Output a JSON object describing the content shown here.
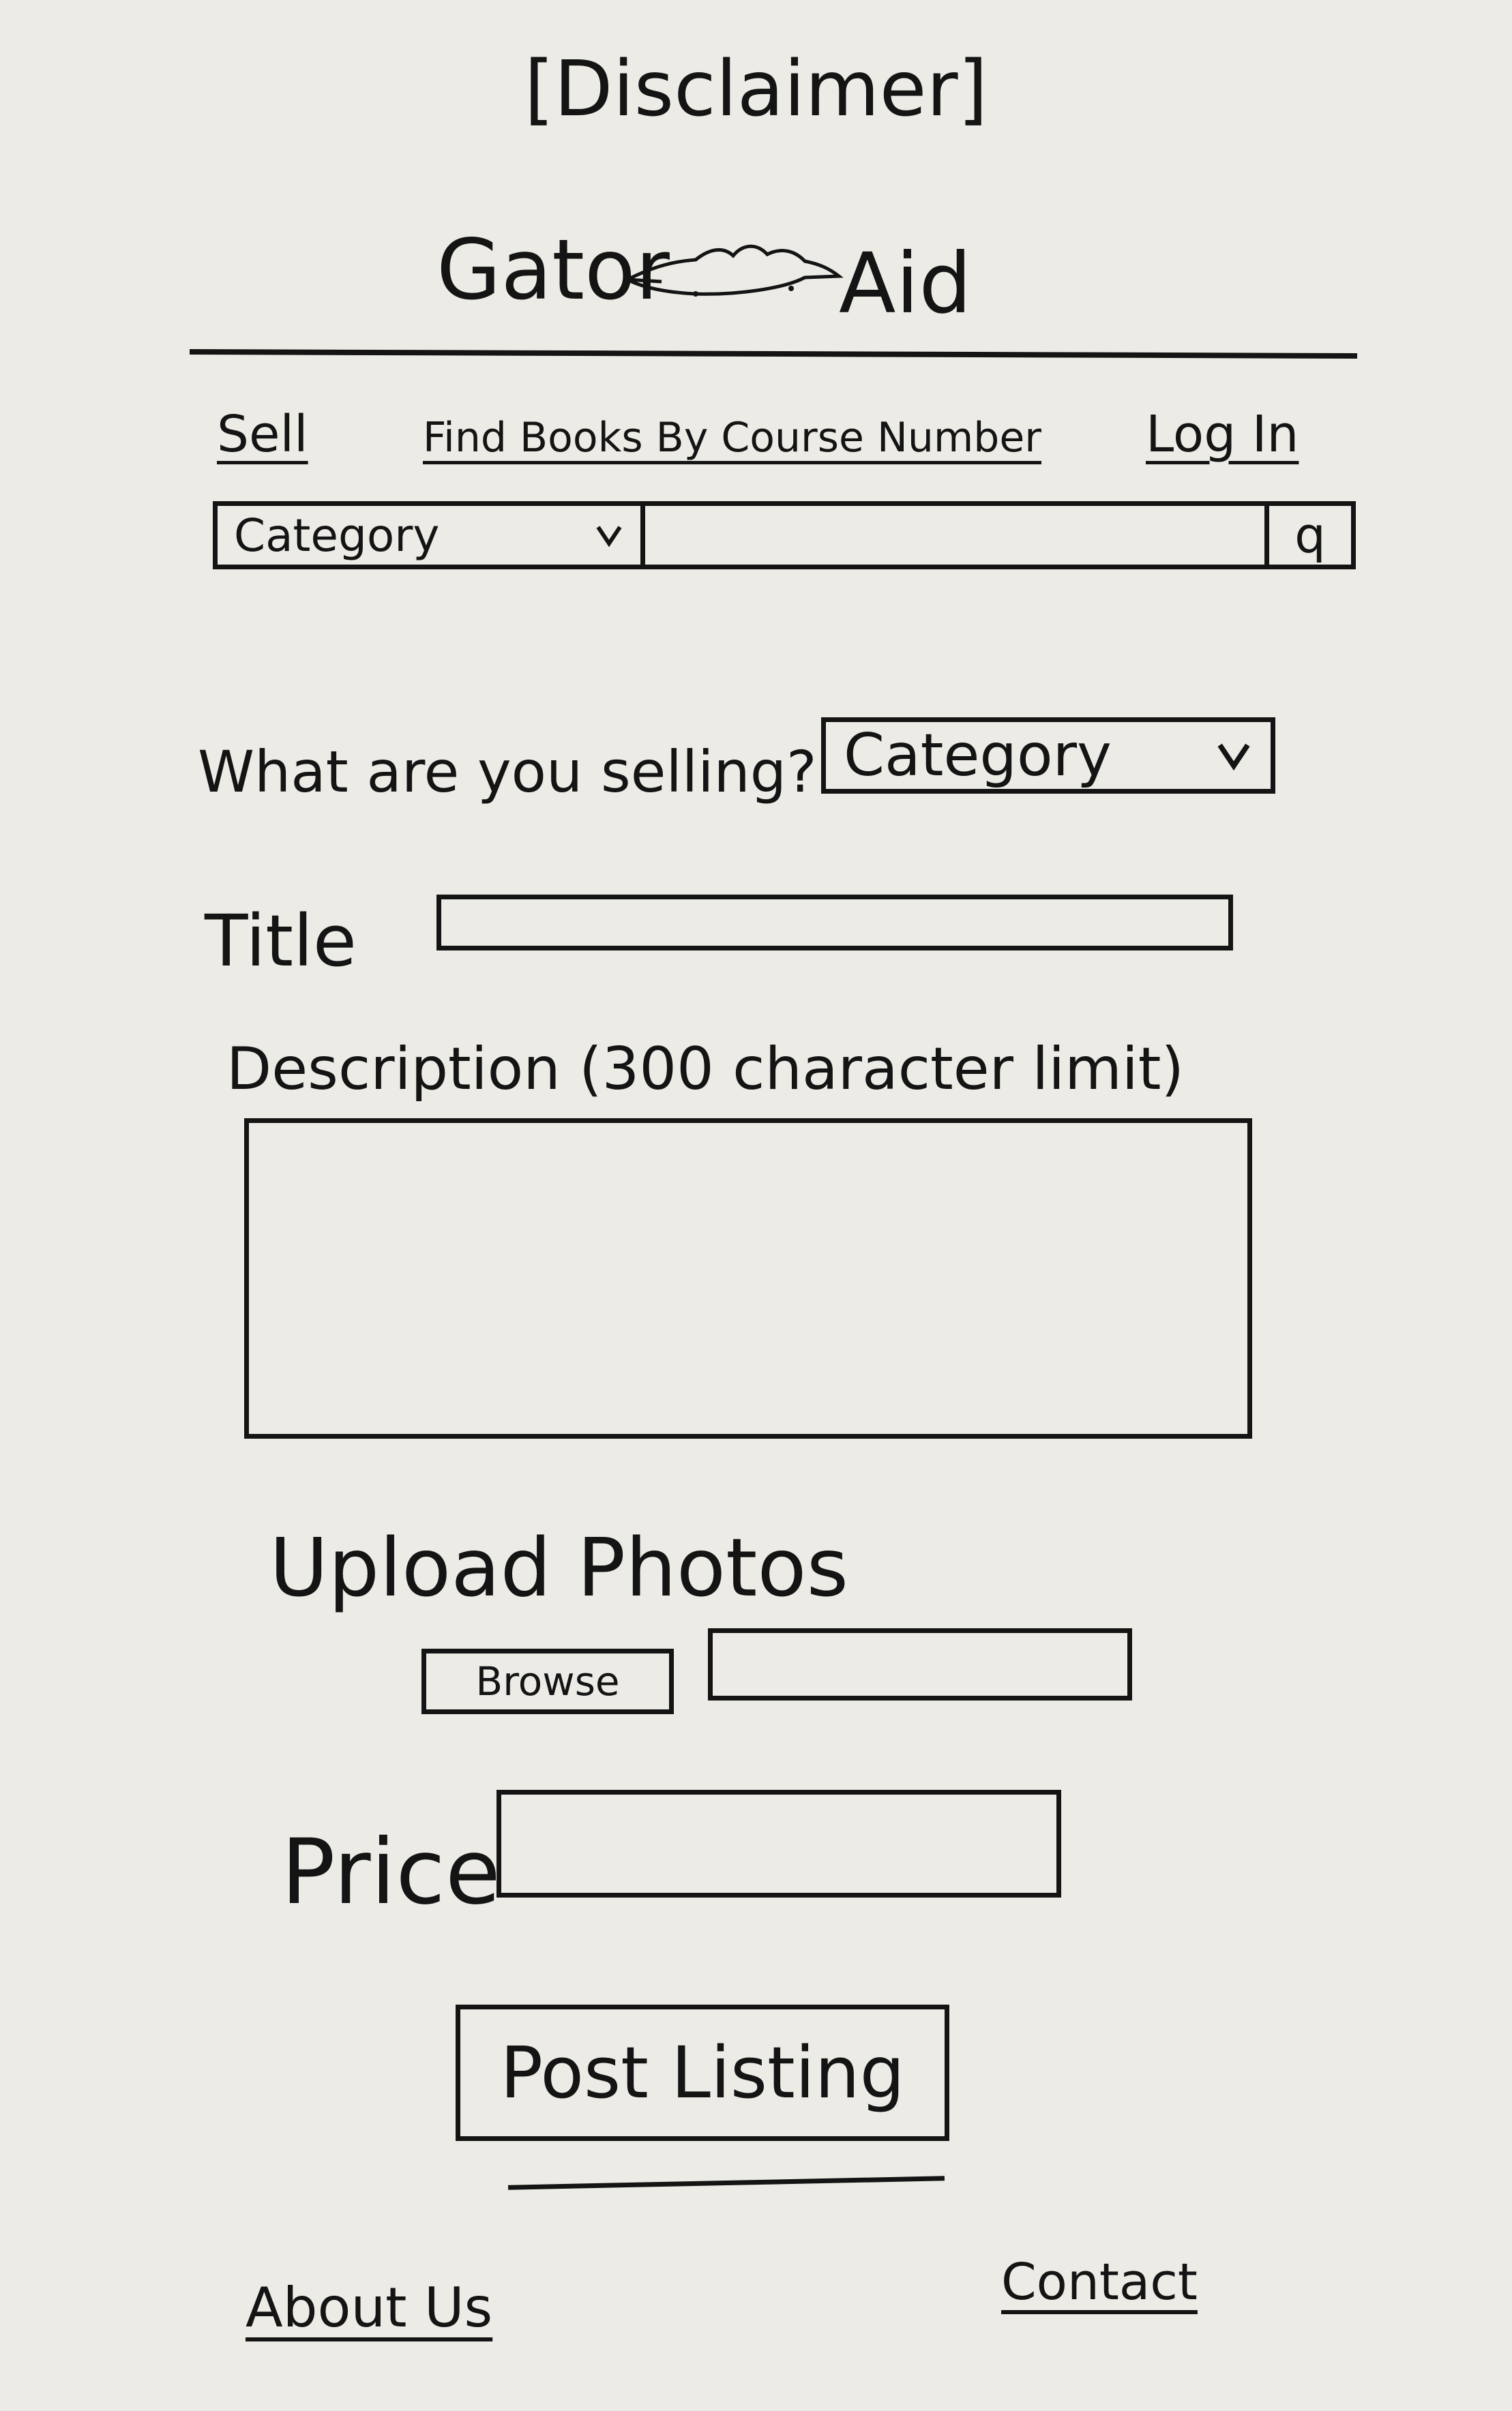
{
  "header": {
    "disclaimer": "[Disclaimer]",
    "brand_left": "Gator",
    "brand_right": "Aid",
    "logo_icon": "gator-icon"
  },
  "nav": {
    "sell": "Sell",
    "find_books": "Find Books By Course Number",
    "login": "Log In"
  },
  "search": {
    "category_label": "Category",
    "dropdown_icon": "chevron-down-icon",
    "search_icon": "search-icon",
    "search_glyph": "q",
    "placeholder": ""
  },
  "form": {
    "selling_label": "What are you selling?",
    "selling_select_value": "Category",
    "title_label": "Title",
    "title_value": "",
    "description_label": "Description (300 character limit)",
    "description_value": "",
    "upload_label": "Upload Photos",
    "browse_label": "Browse",
    "file_name_value": "",
    "price_label": "Price",
    "price_value": "",
    "submit_label": "Post Listing"
  },
  "footer": {
    "about": "About Us",
    "contact": "Contact"
  },
  "colors": {
    "ink": "#141414",
    "board": "#ecebe6"
  }
}
